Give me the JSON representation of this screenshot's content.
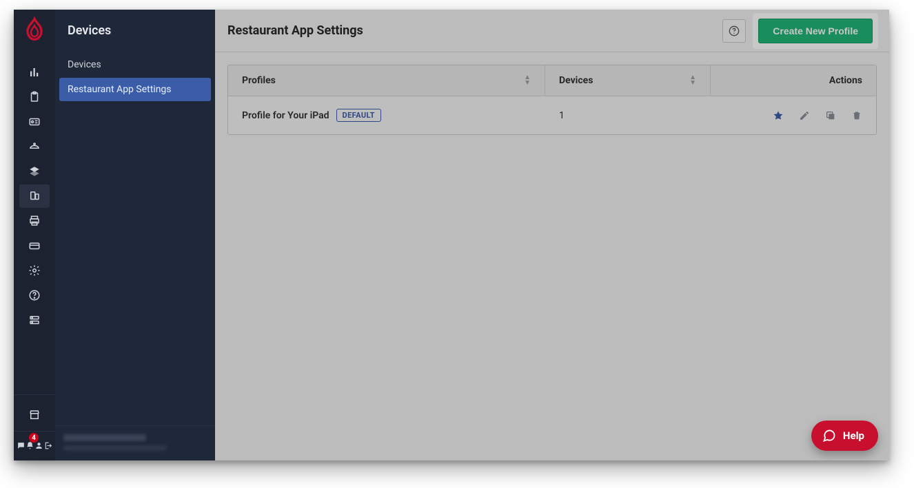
{
  "rail": {
    "notification_count": "4"
  },
  "sidebar": {
    "title": "Devices",
    "items": [
      {
        "label": "Devices"
      },
      {
        "label": "Restaurant App Settings"
      }
    ],
    "active_index": 1
  },
  "header": {
    "title": "Restaurant App Settings",
    "create_label": "Create New Profile"
  },
  "table": {
    "columns": {
      "profiles": "Profiles",
      "devices": "Devices",
      "actions": "Actions"
    },
    "rows": [
      {
        "name": "Profile for Your iPad",
        "badge": "DEFAULT",
        "devices": "1",
        "is_default": true
      }
    ]
  },
  "help_fab": {
    "label": "Help"
  }
}
